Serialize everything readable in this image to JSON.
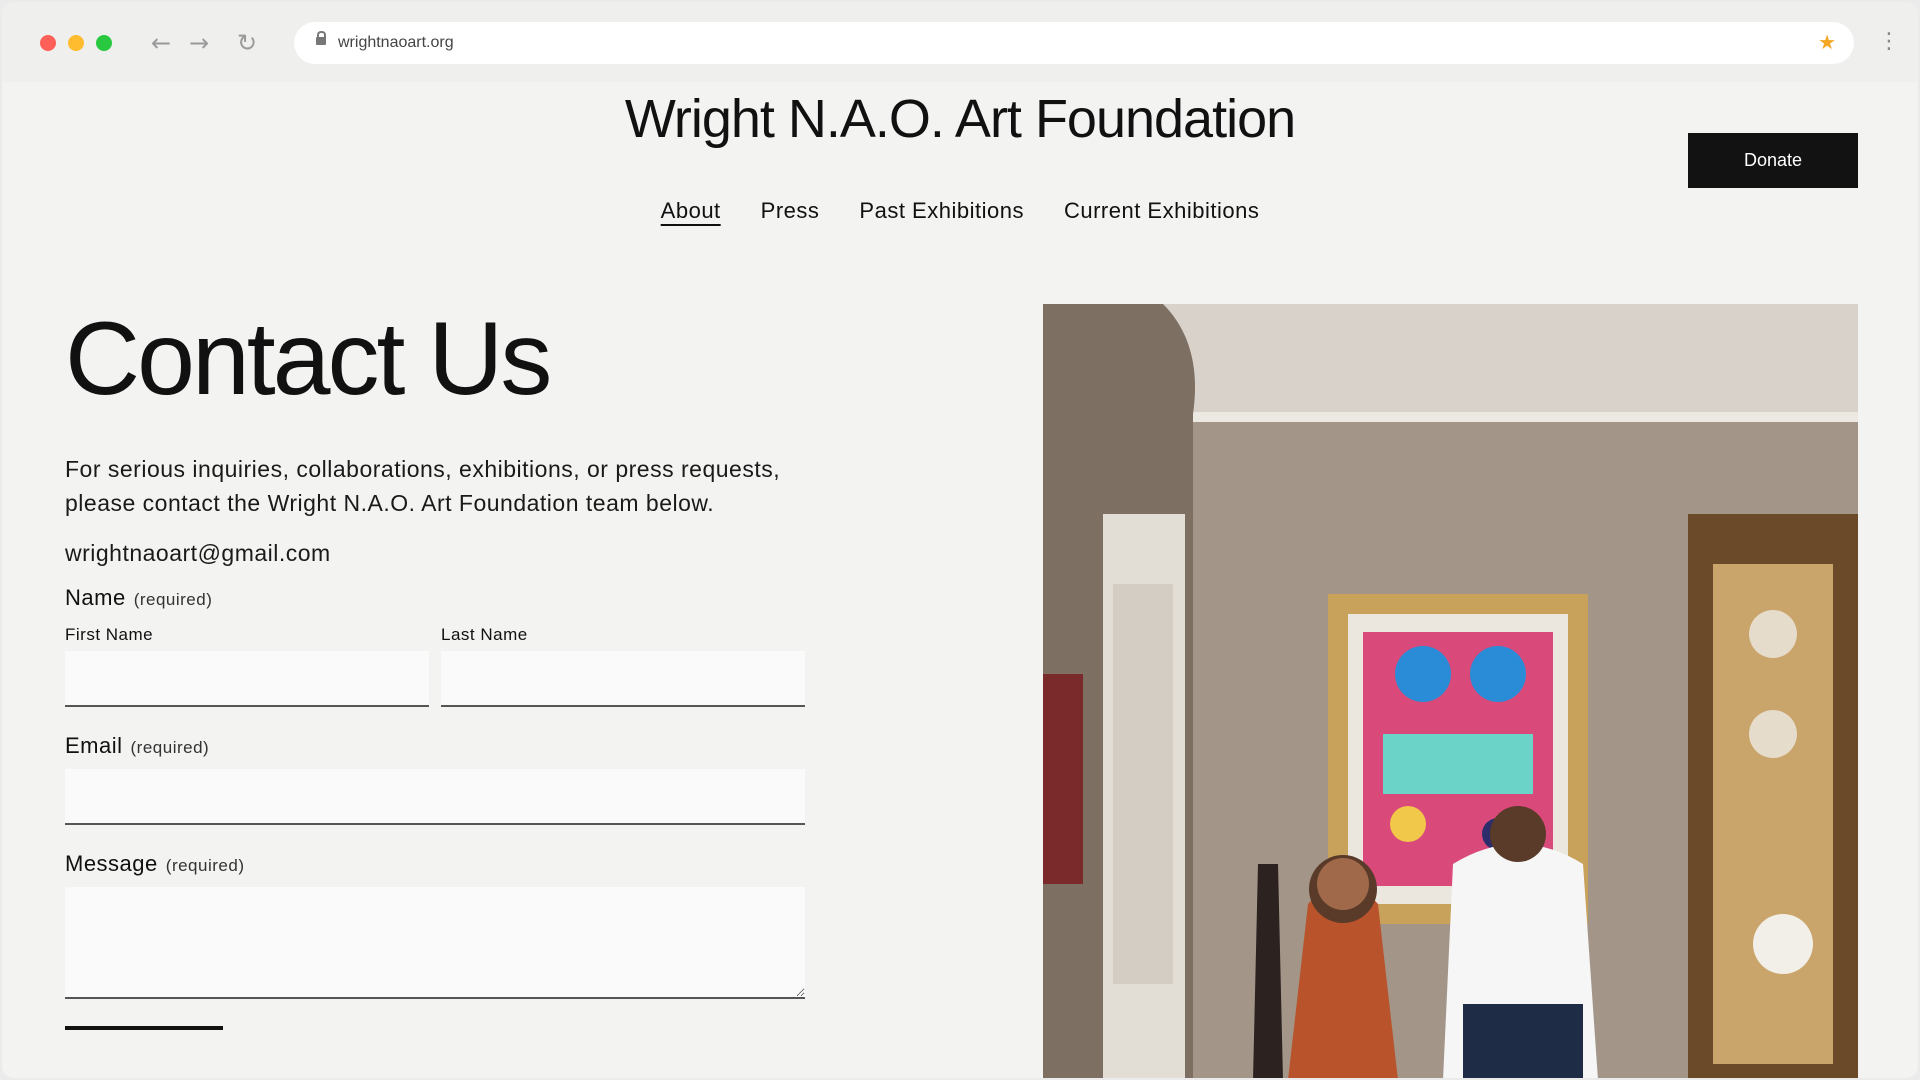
{
  "browser": {
    "url": "wrightnaoart.org",
    "back_icon": "←",
    "forward_icon": "→",
    "reload_icon": "↻",
    "star_icon": "★",
    "menu_icon": "⋮"
  },
  "site": {
    "title": "Wright N.A.O. Art Foundation",
    "donate_label": "Donate",
    "nav": [
      {
        "label": "About"
      },
      {
        "label": "Press"
      },
      {
        "label": "Past Exhibitions"
      },
      {
        "label": "Current Exhibitions"
      }
    ]
  },
  "contact": {
    "heading": "Contact Us",
    "intro": "For serious inquiries, collaborations, exhibitions, or press requests, please contact the Wright N.A.O. Art Foundation team below.",
    "email": "wrightnaoart@gmail.com",
    "required_text": "(required)",
    "name_label": "Name",
    "first_name_label": "First Name",
    "last_name_label": "Last Name",
    "email_label": "Email",
    "message_label": "Message",
    "values": {
      "first_name": "",
      "last_name": "",
      "email": "",
      "message": ""
    }
  },
  "colors": {
    "page_bg": "#f3f3f2",
    "donate_bg": "#121212",
    "text": "#111111"
  }
}
